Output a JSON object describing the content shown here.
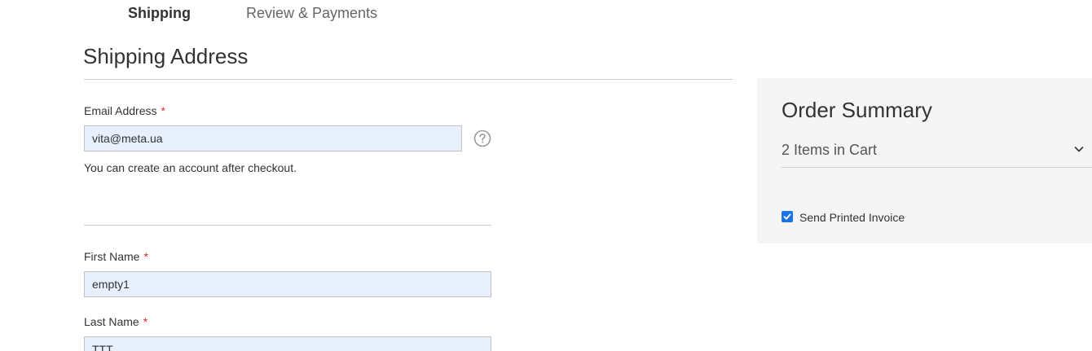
{
  "steps": {
    "shipping": "Shipping",
    "review": "Review & Payments"
  },
  "shipping_address": {
    "title": "Shipping Address",
    "required_marker": "*",
    "email": {
      "label": "Email Address",
      "value": "vita@meta.ua",
      "help_icon": "question-circle-icon"
    },
    "note": "You can create an account after checkout.",
    "first_name": {
      "label": "First Name",
      "value": "empty1"
    },
    "last_name": {
      "label": "Last Name",
      "value": "TTT"
    }
  },
  "order_summary": {
    "title": "Order Summary",
    "cart_toggle": "2 Items in Cart",
    "cart_toggle_icon": "chevron-down-icon",
    "send_printed_invoice": {
      "label": "Send Printed Invoice",
      "checked": true
    }
  },
  "colors": {
    "required": "#e02b27",
    "autofill_bg": "#e8f0fe",
    "checkbox_accent": "#1a73e8",
    "sidebar_bg": "#f5f5f5"
  }
}
